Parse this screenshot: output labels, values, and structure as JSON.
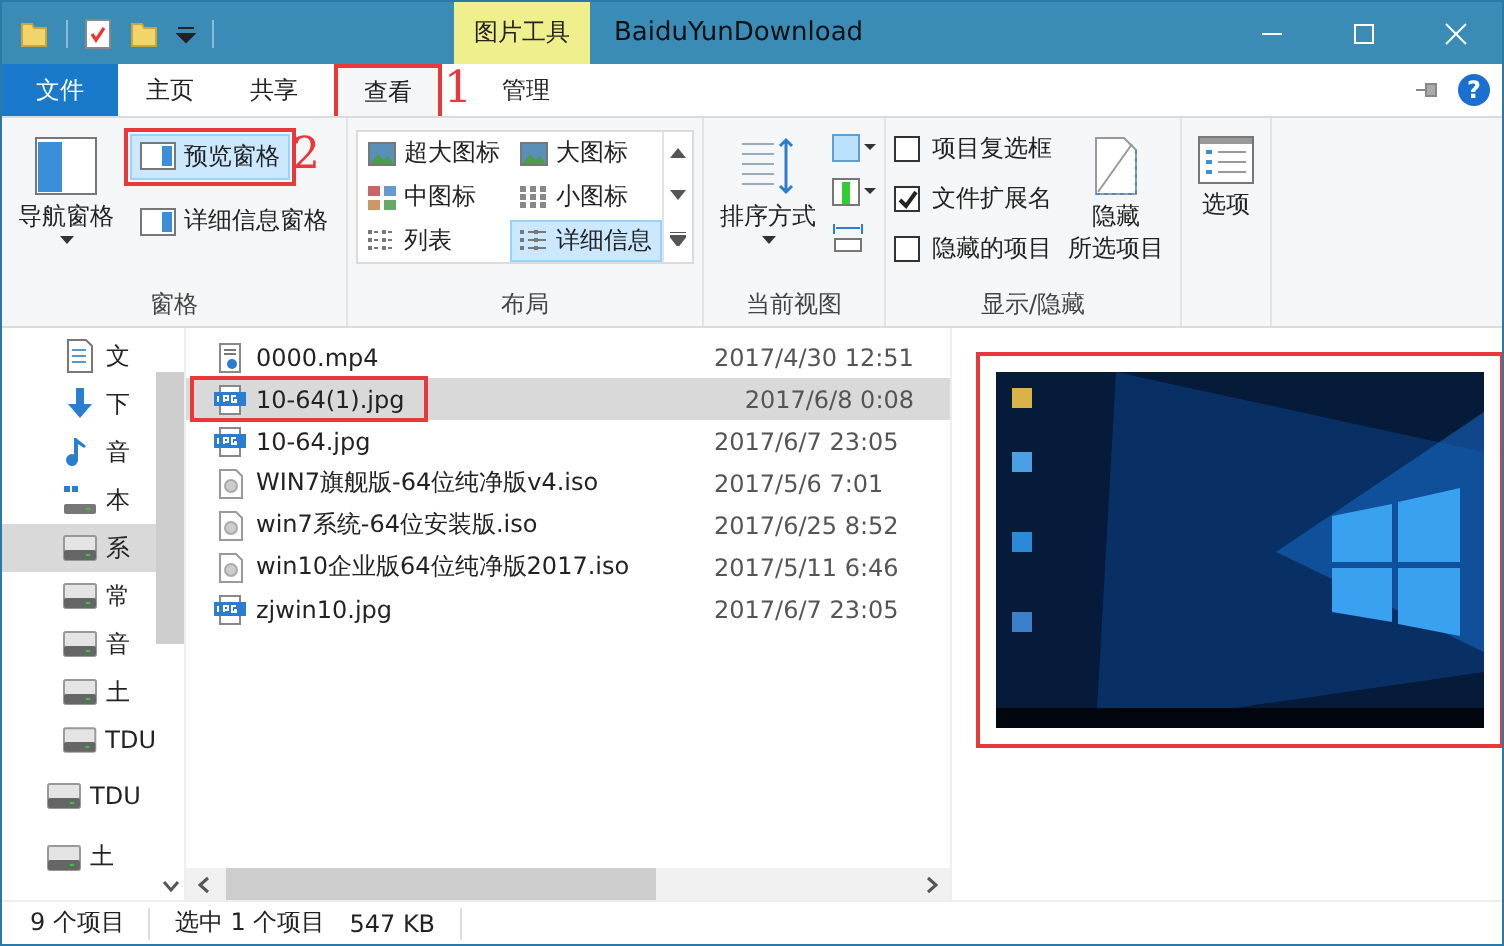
{
  "window": {
    "context_tab": "图片工具",
    "title": "BaiduYunDownload",
    "help": "?"
  },
  "ribbon_tabs": [
    {
      "label": "文件",
      "kind": "file",
      "selected": false
    },
    {
      "label": "主页",
      "kind": "tab",
      "selected": false
    },
    {
      "label": "共享",
      "kind": "tab",
      "selected": false
    },
    {
      "label": "查看",
      "kind": "tab",
      "selected": true
    },
    {
      "label": "管理",
      "kind": "tab",
      "selected": false
    }
  ],
  "annotations": [
    "1",
    "2"
  ],
  "panes": {
    "nav": "导航窗格",
    "preview": {
      "label": "预览窗格",
      "on": true
    },
    "details": "详细信息窗格",
    "group": "窗格"
  },
  "layout": {
    "options": [
      {
        "label": "超大图标",
        "kind": "xl",
        "selected": false
      },
      {
        "label": "大图标",
        "kind": "l",
        "selected": false
      },
      {
        "label": "中图标",
        "kind": "m",
        "selected": false
      },
      {
        "label": "小图标",
        "kind": "s",
        "selected": false
      },
      {
        "label": "列表",
        "kind": "list",
        "selected": false
      },
      {
        "label": "详细信息",
        "kind": "details",
        "selected": true
      }
    ],
    "group": "布局"
  },
  "current_view": {
    "sort": "排序方式",
    "group": "当前视图"
  },
  "show_hide": {
    "checkboxes": [
      {
        "label": "项目复选框",
        "checked": false
      },
      {
        "label": "文件扩展名",
        "checked": true
      },
      {
        "label": "隐藏的项目",
        "checked": false
      }
    ],
    "hide_selected": [
      "隐藏",
      "所选项目"
    ],
    "group": "显示/隐藏"
  },
  "options": "选项",
  "sidebar": {
    "items": [
      {
        "label": "文",
        "kind": "doc",
        "selected": false
      },
      {
        "label": "下",
        "kind": "download",
        "selected": false
      },
      {
        "label": "音",
        "kind": "music",
        "selected": false
      },
      {
        "label": "本",
        "kind": "pc",
        "selected": false
      },
      {
        "label": "系",
        "kind": "drive",
        "selected": true
      },
      {
        "label": "常",
        "kind": "drive",
        "selected": false
      },
      {
        "label": "音",
        "kind": "drive",
        "selected": false
      },
      {
        "label": "土",
        "kind": "drive",
        "selected": false
      },
      {
        "label": "TDU",
        "kind": "drive",
        "selected": false
      },
      {
        "label": "TDU",
        "kind": "drive-top",
        "selected": false
      },
      {
        "label": "土",
        "kind": "drive-top",
        "selected": false
      }
    ]
  },
  "files": [
    {
      "name": "0000.mp4",
      "date": "2017/4/30 12:51",
      "kind": "video",
      "selected": false
    },
    {
      "name": "10-64(1).jpg",
      "date": "2017/6/8 0:08",
      "kind": "jpg",
      "selected": true
    },
    {
      "name": "10-64.jpg",
      "date": "2017/6/7 23:05",
      "kind": "jpg",
      "selected": false
    },
    {
      "name": "WIN7旗舰版-64位纯净版v4.iso",
      "date": "2017/5/6 7:01",
      "kind": "iso",
      "selected": false
    },
    {
      "name": "win7系统-64位安装版.iso",
      "date": "2017/6/25 8:52",
      "kind": "iso",
      "selected": false
    },
    {
      "name": "win10企业版64位纯净版2017.iso",
      "date": "2017/5/11 6:46",
      "kind": "iso",
      "selected": false
    },
    {
      "name": "zjwin10.jpg",
      "date": "2017/6/7 23:05",
      "kind": "jpg",
      "selected": false
    }
  ],
  "preview": {
    "kind": "picture"
  },
  "status_bar": {
    "count": "9 个项目",
    "selection": "选中 1 个项目",
    "size": "547 KB"
  }
}
